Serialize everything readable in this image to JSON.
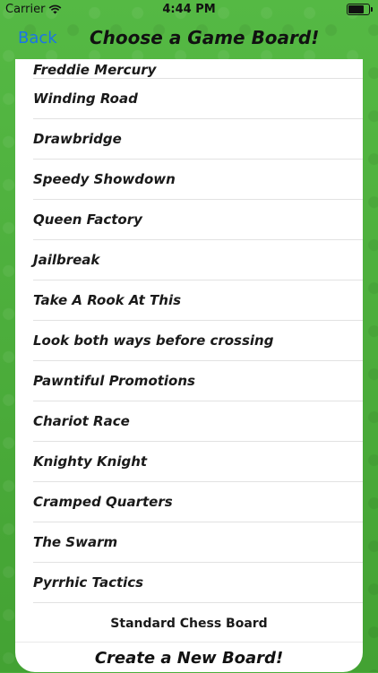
{
  "status_bar": {
    "carrier": "Carrier",
    "time": "4:44 PM",
    "wifi_icon": "wifi-icon",
    "battery_icon": "battery-icon"
  },
  "nav": {
    "back_label": "Back",
    "title": "Choose a Game Board!"
  },
  "boards": [
    "Freddie Mercury",
    "Winding Road",
    "Drawbridge",
    "Speedy Showdown",
    "Queen Factory",
    "Jailbreak",
    "Take A Rook At This",
    "Look both ways before crossing",
    "Pawntiful Promotions",
    "Chariot Race",
    "Knighty Knight",
    "Cramped Quarters",
    "The Swarm",
    "Pyrrhic Tactics"
  ],
  "standard_board_label": "Standard Chess Board",
  "create_button_label": "Create a New Board!",
  "colors": {
    "felt": "#4cae3c",
    "link": "#1a73e8"
  }
}
